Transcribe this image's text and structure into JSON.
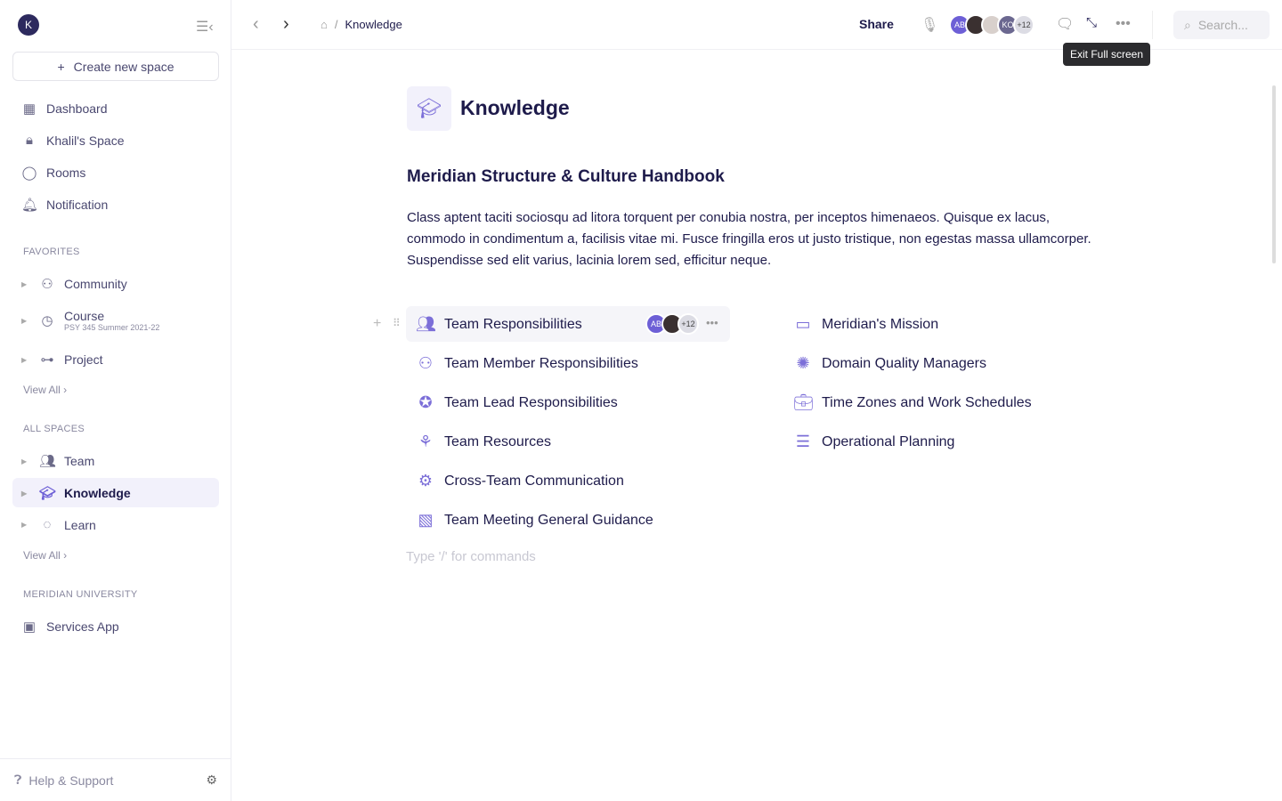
{
  "sidebar": {
    "user_initial": "K",
    "create_label": "Create new space",
    "nav": [
      {
        "label": "Dashboard",
        "icon": "grid-icon"
      },
      {
        "label": "Khalil's Space",
        "icon": "lock-icon"
      },
      {
        "label": "Rooms",
        "icon": "chat-icon"
      },
      {
        "label": "Notification",
        "icon": "bell-icon"
      }
    ],
    "favorites_title": "FAVORITES",
    "favorites": [
      {
        "label": "Community"
      },
      {
        "label": "Course",
        "sub": "PSY 345 Summer 2021-22"
      },
      {
        "label": "Project"
      }
    ],
    "view_all": "View All",
    "all_spaces_title": "ALL SPACES",
    "spaces": [
      {
        "label": "Team"
      },
      {
        "label": "Knowledge"
      },
      {
        "label": "Learn"
      }
    ],
    "org_title": "MERIDIAN UNIVERSITY",
    "org_items": [
      {
        "label": "Services App"
      }
    ],
    "help": "Help & Support"
  },
  "topbar": {
    "breadcrumb": "Knowledge",
    "share": "Share",
    "avatars": [
      "AB",
      "",
      "",
      "KO"
    ],
    "more_count": "+12",
    "tooltip": "Exit Full screen",
    "search_placeholder": "Search..."
  },
  "page": {
    "title": "Knowledge",
    "heading": "Meridian Structure & Culture Handbook",
    "body": "Class aptent taciti sociosqu ad litora torquent per conubia nostra, per inceptos himenaeos. Quisque ex lacus, commodo in condimentum a, facilisis vitae mi. Fusce fringilla eros ut justo tristique, non egestas massa ullamcorper. Suspendisse sed elit varius, lacinia lorem sed, efficitur neque.",
    "left_items": [
      "Team Responsibilities",
      "Team Member Responsibilities",
      "Team Lead Responsibilities",
      "Team Resources",
      "Cross-Team Communication",
      "Team Meeting General Guidance"
    ],
    "right_items": [
      "Meridian's Mission",
      "Domain Quality Managers",
      "Time Zones and Work Schedules",
      "Operational Planning"
    ],
    "row_avatar": "AB",
    "row_count": "+12",
    "placeholder": "Type '/' for commands"
  },
  "colors": {
    "accent": "#7c6fd8",
    "text": "#1e1b4b"
  }
}
